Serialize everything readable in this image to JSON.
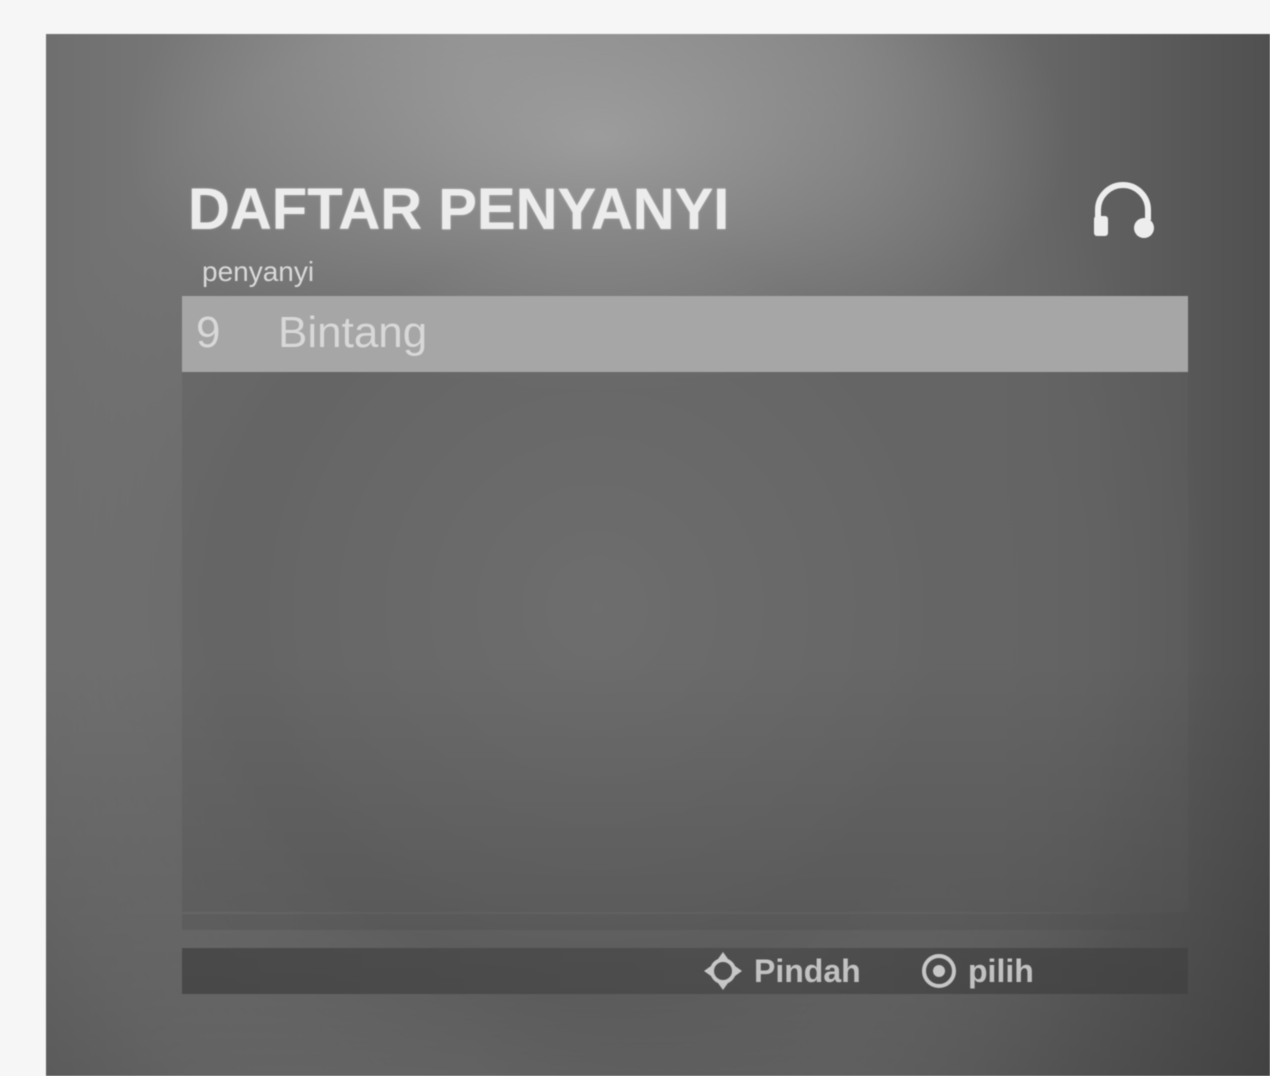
{
  "screen": {
    "title": "DAFTAR PENYANYI",
    "status_icon": "headphone-icon",
    "column_header": "penyanyi"
  },
  "list": {
    "items": [
      {
        "number": "9",
        "name": "Bintang",
        "selected": true
      }
    ]
  },
  "footer": {
    "move": {
      "icon": "dpad-icon",
      "label": "Pindah"
    },
    "select": {
      "icon": "enter-button-icon",
      "label": "pilih"
    }
  }
}
